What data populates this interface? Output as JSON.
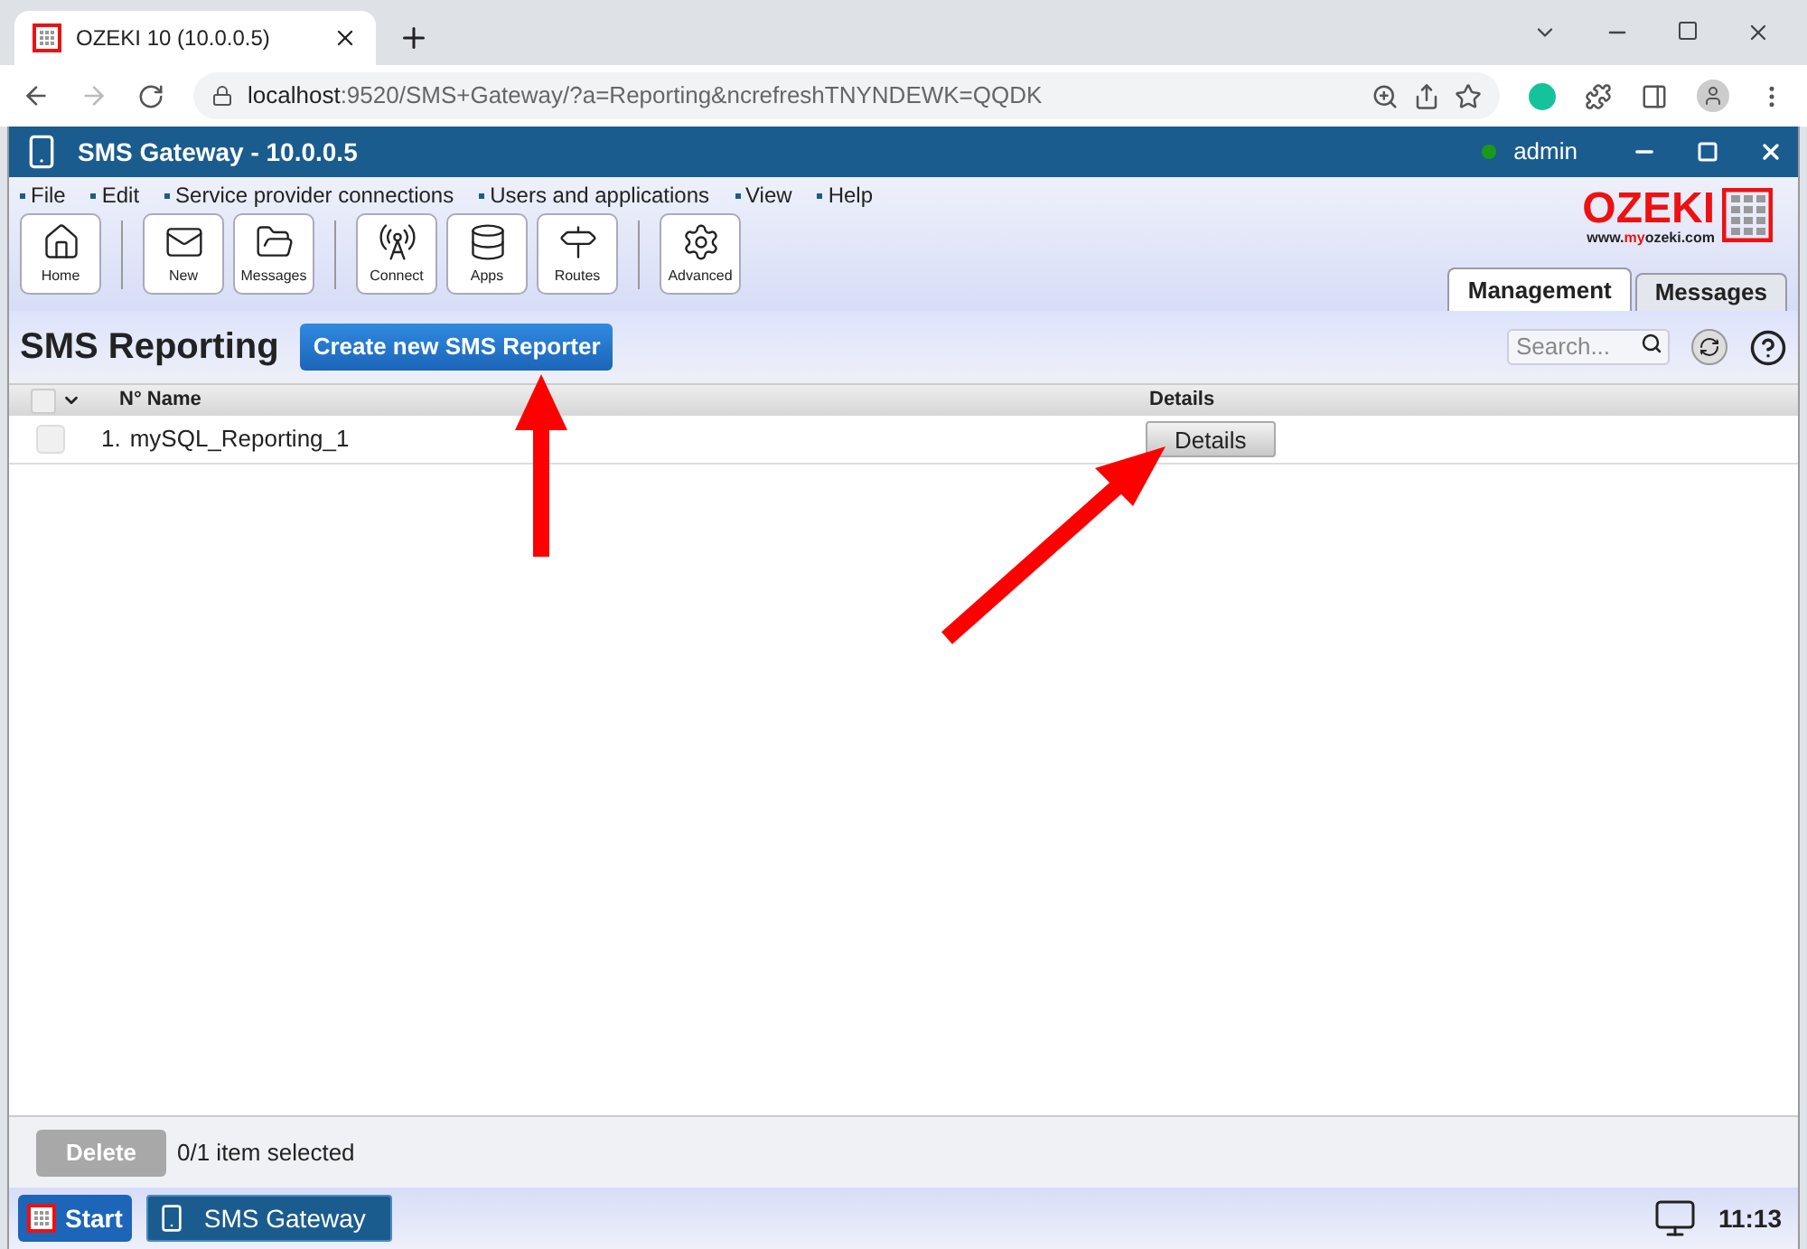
{
  "browser": {
    "tab_title": "OZEKI 10 (10.0.0.5)",
    "url_host": "localhost",
    "url_rest": ":9520/SMS+Gateway/?a=Reporting&ncrefreshTNYNDEWK=QQDK"
  },
  "app_header": {
    "title": "SMS Gateway - 10.0.0.5",
    "user": "admin",
    "user_online": true
  },
  "menu": [
    "File",
    "Edit",
    "Service provider connections",
    "Users and applications",
    "View",
    "Help"
  ],
  "toolbar_groups": [
    [
      {
        "kind": "home",
        "label": "Home"
      }
    ],
    [
      {
        "kind": "new",
        "label": "New"
      },
      {
        "kind": "messages",
        "label": "Messages"
      }
    ],
    [
      {
        "kind": "connect",
        "label": "Connect"
      },
      {
        "kind": "apps",
        "label": "Apps"
      },
      {
        "kind": "routes",
        "label": "Routes"
      }
    ],
    [
      {
        "kind": "advanced",
        "label": "Advanced"
      }
    ]
  ],
  "logo": {
    "name": "OZEKI",
    "url_prefix": "www.",
    "url_highlight": "my",
    "url_suffix": "ozeki.com"
  },
  "tabs": [
    {
      "label": "Management",
      "selected": true
    },
    {
      "label": "Messages",
      "selected": false
    }
  ],
  "page": {
    "title": "SMS Reporting",
    "create_button": "Create new SMS Reporter",
    "search_placeholder": "Search..."
  },
  "table": {
    "select_all_checked": false,
    "columns": [
      "N° Name",
      "Details"
    ],
    "rows": [
      {
        "number": "1.",
        "name": "mySQL_Reporting_1",
        "details_button": "Details",
        "checked": false
      }
    ]
  },
  "footer": {
    "delete_button": "Delete",
    "selection": "0/1 item selected"
  },
  "taskbar": {
    "start": "Start",
    "app": "SMS Gateway",
    "time": "11:13"
  }
}
